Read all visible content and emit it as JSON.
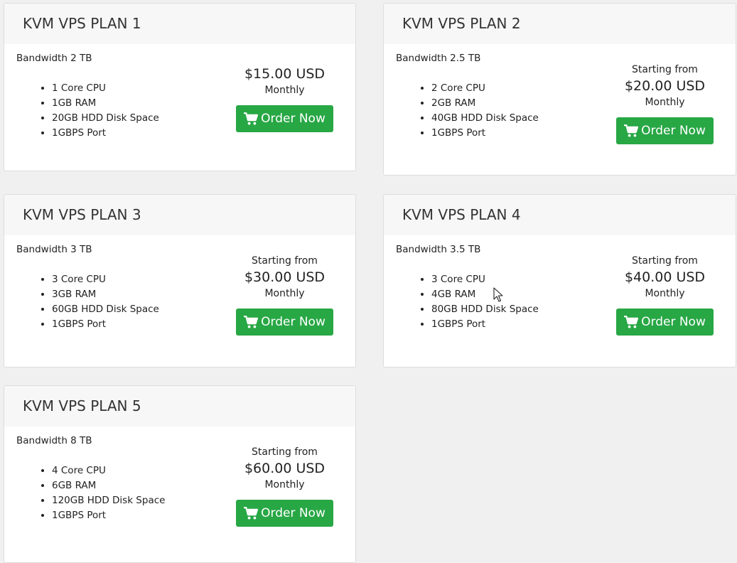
{
  "colors": {
    "background": "#f0f0f0",
    "card_header": "#f7f7f7",
    "button_green": "#28a745",
    "text": "#222222"
  },
  "icons": {
    "order_button": "shopping-cart-icon",
    "pointer": "mouse-cursor-icon"
  },
  "plans": [
    {
      "title": "KVM VPS PLAN 1",
      "bandwidth": "Bandwidth 2 TB",
      "features": [
        "1 Core CPU",
        "1GB RAM",
        "20GB HDD Disk Space",
        "1GBPS Port"
      ],
      "starting_from": "",
      "price": "$15.00 USD",
      "period": "Monthly",
      "button_label": "Order Now"
    },
    {
      "title": "KVM VPS PLAN 2",
      "bandwidth": "Bandwidth 2.5 TB",
      "features": [
        "2 Core CPU",
        "2GB RAM",
        "40GB HDD Disk Space",
        "1GBPS Port"
      ],
      "starting_from": "Starting from",
      "price": "$20.00 USD",
      "period": "Monthly",
      "button_label": "Order Now"
    },
    {
      "title": "KVM VPS PLAN 3",
      "bandwidth": "Bandwidth 3 TB",
      "features": [
        "3 Core CPU",
        "3GB RAM",
        "60GB HDD Disk Space",
        "1GBPS Port"
      ],
      "starting_from": "Starting from",
      "price": "$30.00 USD",
      "period": "Monthly",
      "button_label": "Order Now"
    },
    {
      "title": "KVM VPS PLAN 4",
      "bandwidth": "Bandwidth 3.5 TB",
      "features": [
        "3 Core CPU",
        "4GB RAM",
        "80GB HDD Disk Space",
        "1GBPS Port"
      ],
      "starting_from": "Starting from",
      "price": "$40.00 USD",
      "period": "Monthly",
      "button_label": "Order Now"
    },
    {
      "title": "KVM VPS PLAN 5",
      "bandwidth": "Bandwidth 8 TB",
      "features": [
        "4 Core CPU",
        "6GB RAM",
        "120GB HDD Disk Space",
        "1GBPS Port"
      ],
      "starting_from": "Starting from",
      "price": "$60.00 USD",
      "period": "Monthly",
      "button_label": "Order Now"
    }
  ]
}
